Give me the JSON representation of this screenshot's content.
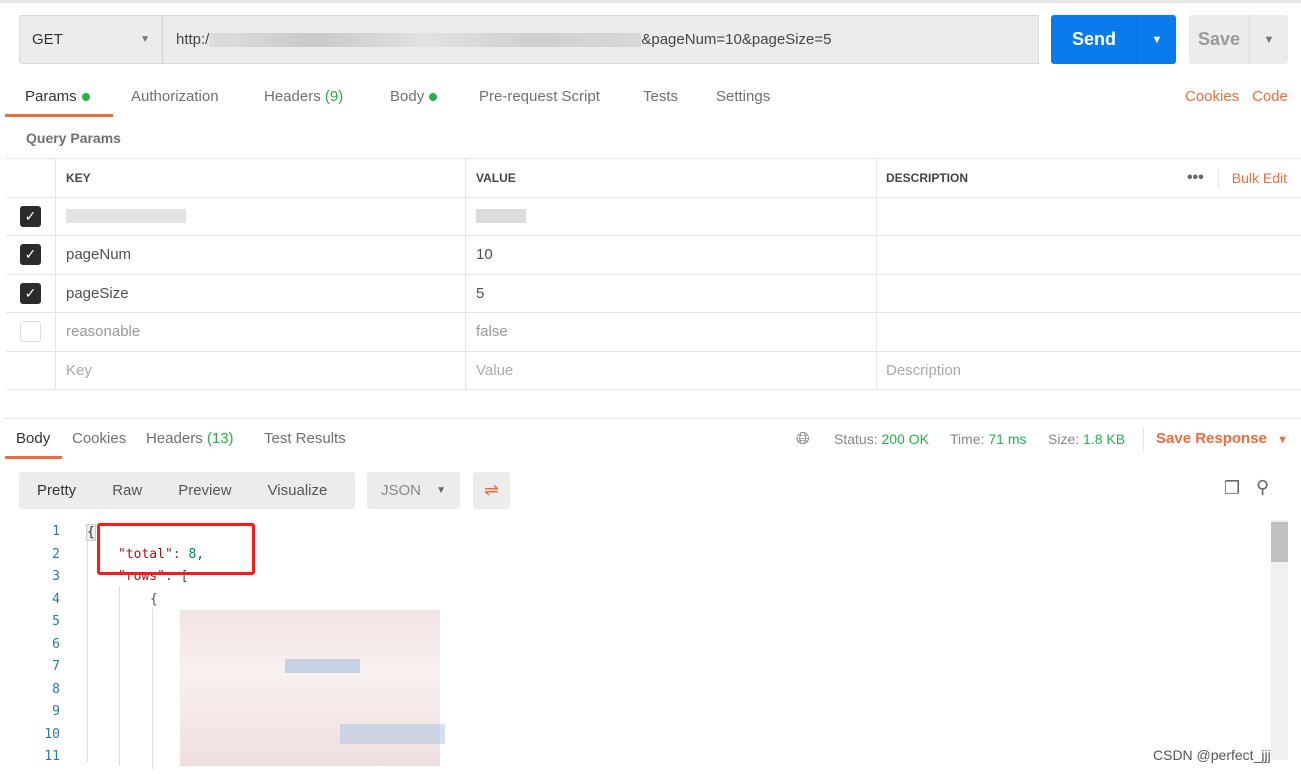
{
  "request": {
    "method": "GET",
    "url_prefix": "http:/",
    "url_suffix": "&pageNum=10&pageSize=5",
    "send_label": "Send",
    "save_label": "Save"
  },
  "tabs": [
    {
      "label": "Params",
      "dot": true
    },
    {
      "label": "Authorization"
    },
    {
      "label": "Headers",
      "count": "(9)"
    },
    {
      "label": "Body",
      "dot": true
    },
    {
      "label": "Pre-request Script"
    },
    {
      "label": "Tests"
    },
    {
      "label": "Settings"
    }
  ],
  "links": {
    "cookies": "Cookies",
    "code": "Code"
  },
  "query_params": {
    "title": "Query Params",
    "headers": [
      "KEY",
      "VALUE",
      "DESCRIPTION"
    ],
    "bulk_edit": "Bulk Edit",
    "rows": [
      {
        "checked": true,
        "key": "",
        "value": ""
      },
      {
        "checked": true,
        "key": "pageNum",
        "value": "10"
      },
      {
        "checked": true,
        "key": "pageSize",
        "value": "5"
      },
      {
        "checked": false,
        "key": "reasonable",
        "value": "false"
      }
    ],
    "placeholders": {
      "key": "Key",
      "value": "Value",
      "description": "Description"
    }
  },
  "response": {
    "tabs": [
      {
        "label": "Body"
      },
      {
        "label": "Cookies"
      },
      {
        "label": "Headers",
        "count": "(13)"
      },
      {
        "label": "Test Results"
      }
    ],
    "status_label": "Status:",
    "status": "200 OK",
    "time_label": "Time:",
    "time": "71 ms",
    "size_label": "Size:",
    "size": "1.8 KB",
    "save_response": "Save Response",
    "views": [
      "Pretty",
      "Raw",
      "Preview",
      "Visualize"
    ],
    "format": "JSON",
    "line_numbers": [
      "1",
      "2",
      "3",
      "4",
      "5",
      "6",
      "7",
      "8",
      "9",
      "10",
      "11"
    ],
    "code": {
      "l1": "{",
      "l2_key": "\"total\"",
      "l2_val": "8",
      "l3_key": "\"rows\"",
      "l3_rest": "[",
      "l4": "{"
    }
  },
  "watermark": "CSDN @perfect_jjj",
  "colors": {
    "accent": "#f26b3a",
    "send": "#097bed",
    "success": "#26b047"
  }
}
